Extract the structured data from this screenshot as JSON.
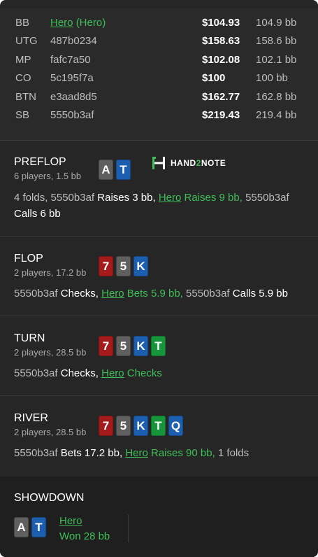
{
  "players": [
    {
      "pos": "BB",
      "name": "Hero",
      "tag": "(Hero)",
      "stack": "$104.93",
      "bb": "104.9 bb",
      "is_hero": true
    },
    {
      "pos": "UTG",
      "name": "487b0234",
      "stack": "$158.63",
      "bb": "158.6 bb"
    },
    {
      "pos": "MP",
      "name": "fafc7a50",
      "stack": "$102.08",
      "bb": "102.1 bb"
    },
    {
      "pos": "CO",
      "name": "5c195f7a",
      "stack": "$100",
      "bb": "100 bb"
    },
    {
      "pos": "BTN",
      "name": "e3aad8d5",
      "stack": "$162.77",
      "bb": "162.8 bb"
    },
    {
      "pos": "SB",
      "name": "5550b3af",
      "stack": "$219.43",
      "bb": "219.4 bb"
    }
  ],
  "logo": {
    "pre": "HAND",
    "two": "2",
    "post": "NOTE"
  },
  "preflop": {
    "title": "PREFLOP",
    "sub": "6 players, 1.5 bb",
    "cards": [
      {
        "rank": "A",
        "color": "grey"
      },
      {
        "rank": "T",
        "color": "blue"
      }
    ],
    "a1": "4 folds, 5550b3af",
    "a2": "Raises 3 bb,",
    "a3": "Hero",
    "a4": "Raises 9 bb,",
    "a5": "5550b3af",
    "a6": "Calls 6 bb"
  },
  "flop": {
    "title": "FLOP",
    "sub": "2 players, 17.2 bb",
    "cards": [
      {
        "rank": "7",
        "color": "red"
      },
      {
        "rank": "5",
        "color": "grey"
      },
      {
        "rank": "K",
        "color": "blue"
      }
    ],
    "a1": "5550b3af",
    "a2": "Checks,",
    "a3": "Hero",
    "a4": "Bets 5.9 bb,",
    "a5": "5550b3af",
    "a6": "Calls 5.9 bb"
  },
  "turn": {
    "title": "TURN",
    "sub": "2 players, 28.5 bb",
    "cards": [
      {
        "rank": "7",
        "color": "red"
      },
      {
        "rank": "5",
        "color": "grey"
      },
      {
        "rank": "K",
        "color": "blue"
      },
      {
        "rank": "T",
        "color": "green"
      }
    ],
    "a1": "5550b3af",
    "a2": "Checks,",
    "a3": "Hero",
    "a4": "Checks"
  },
  "river": {
    "title": "RIVER",
    "sub": "2 players, 28.5 bb",
    "cards": [
      {
        "rank": "7",
        "color": "red"
      },
      {
        "rank": "5",
        "color": "grey"
      },
      {
        "rank": "K",
        "color": "blue"
      },
      {
        "rank": "T",
        "color": "green"
      },
      {
        "rank": "Q",
        "color": "blue"
      }
    ],
    "a1": "5550b3af",
    "a2": "Bets 17.2 bb,",
    "a3": "Hero",
    "a4": "Raises 90 bb,",
    "a5": "1 folds"
  },
  "showdown": {
    "title": "SHOWDOWN",
    "cards": [
      {
        "rank": "A",
        "color": "grey"
      },
      {
        "rank": "T",
        "color": "blue"
      }
    ],
    "player": "Hero",
    "result": "Won 28 bb"
  },
  "colors": {
    "red": "#a51a1a",
    "grey": "#5f5f5f",
    "blue": "#1c5fb0",
    "green": "#16953a",
    "hero": "#3fbf57"
  }
}
